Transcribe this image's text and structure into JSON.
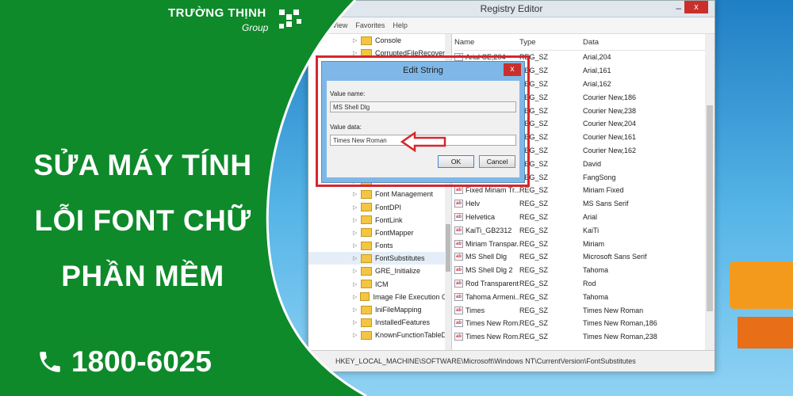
{
  "brand": {
    "name": "TRƯỜNG THỊNH",
    "sub": "Group"
  },
  "headline": [
    "SỬA MÁY TÍNH",
    "LỖI FONT CHỮ",
    "PHẦN MỀM"
  ],
  "phone": "1800-6025",
  "colors": {
    "green": "#0e8a2a",
    "highlight": "#d6272c",
    "dialog": "#7fb8e8"
  },
  "registry": {
    "title": "Registry Editor",
    "menu": [
      "View",
      "Favorites",
      "Help"
    ],
    "tree_items": [
      "Console",
      "CorruptedFileRecovery",
      "",
      "",
      "",
      "",
      "",
      "",
      "",
      "",
      "",
      "",
      "Font Management",
      "FontDPI",
      "FontLink",
      "FontMapper",
      "Fonts",
      "FontSubstitutes",
      "GRE_Initialize",
      "ICM",
      "Image File Execution Op",
      "IniFileMapping",
      "InstalledFeatures",
      "KnownFunctionTableDl"
    ],
    "columns": {
      "name": "Name",
      "type": "Type",
      "data": "Data"
    },
    "rows": [
      {
        "name": "Arial CE,204",
        "type": "REG_SZ",
        "data": "Arial,204"
      },
      {
        "name": "",
        "type": "REG_SZ",
        "data": "Arial,161"
      },
      {
        "name": "",
        "type": "REG_SZ",
        "data": "Arial,162"
      },
      {
        "name": "",
        "type": "REG_SZ",
        "data": "Courier New,186"
      },
      {
        "name": "",
        "type": "REG_SZ",
        "data": "Courier New,238"
      },
      {
        "name": "",
        "type": "REG_SZ",
        "data": "Courier New,204"
      },
      {
        "name": "",
        "type": "REG_SZ",
        "data": "Courier New,161"
      },
      {
        "name": "",
        "type": "REG_SZ",
        "data": "Courier New,162"
      },
      {
        "name": "",
        "type": "REG_SZ",
        "data": "David"
      },
      {
        "name": "",
        "type": "REG_SZ",
        "data": "FangSong"
      },
      {
        "name": "Fixed Miriam Tr...",
        "type": "REG_SZ",
        "data": "Miriam Fixed"
      },
      {
        "name": "Helv",
        "type": "REG_SZ",
        "data": "MS Sans Serif"
      },
      {
        "name": "Helvetica",
        "type": "REG_SZ",
        "data": "Arial"
      },
      {
        "name": "KaiTi_GB2312",
        "type": "REG_SZ",
        "data": "KaiTi"
      },
      {
        "name": "Miriam Transpar...",
        "type": "REG_SZ",
        "data": "Miriam"
      },
      {
        "name": "MS Shell Dlg",
        "type": "REG_SZ",
        "data": "Microsoft Sans Serif"
      },
      {
        "name": "MS Shell Dlg 2",
        "type": "REG_SZ",
        "data": "Tahoma"
      },
      {
        "name": "Rod Transparent",
        "type": "REG_SZ",
        "data": "Rod"
      },
      {
        "name": "Tahoma Armeni...",
        "type": "REG_SZ",
        "data": "Tahoma"
      },
      {
        "name": "Times",
        "type": "REG_SZ",
        "data": "Times New Roman"
      },
      {
        "name": "Times New Rom...",
        "type": "REG_SZ",
        "data": "Times New Roman,186"
      },
      {
        "name": "Times New Rom...",
        "type": "REG_SZ",
        "data": "Times New Roman,238"
      }
    ],
    "status_path": "HKEY_LOCAL_MACHINE\\SOFTWARE\\Microsoft\\Windows NT\\CurrentVersion\\FontSubstitutes"
  },
  "dialog": {
    "title": "Edit String",
    "value_name_label": "Value name:",
    "value_name": "MS Shell Dlg",
    "value_data_label": "Value data:",
    "value_data": "Times New Roman",
    "ok_label": "OK",
    "cancel_label": "Cancel",
    "close_glyph": "x"
  },
  "window_glyphs": {
    "close": "x",
    "minimize": "–"
  },
  "icons": {
    "phone": "phone-icon",
    "arrow": "arrow-left-icon",
    "logo": "brand-logo-icon"
  }
}
